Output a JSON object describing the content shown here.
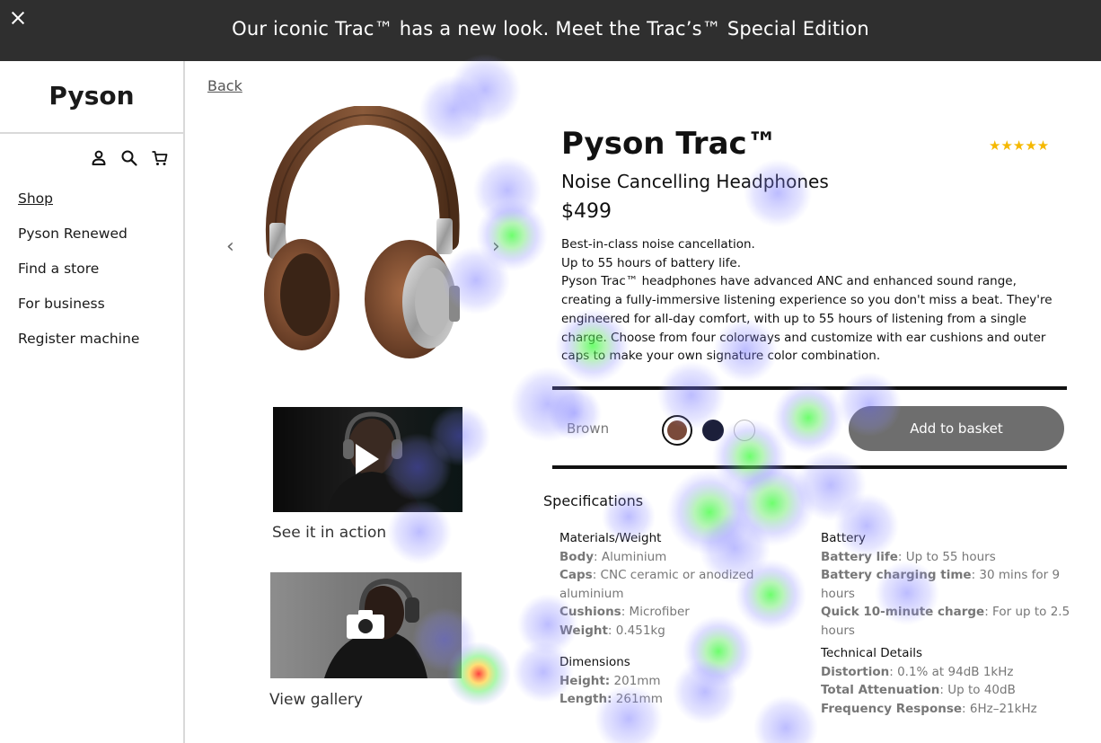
{
  "banner": {
    "text": "Our iconic Trac™ has a new look. Meet the Trac’s™ Special Edition",
    "close_icon": "close-icon"
  },
  "sidebar": {
    "logo": "Pyson",
    "icons": [
      "user-icon",
      "search-icon",
      "cart-icon"
    ],
    "nav": [
      {
        "label": "Shop"
      },
      {
        "label": "Pyson Renewed"
      },
      {
        "label": "Find a store"
      },
      {
        "label": "For business"
      },
      {
        "label": "Register machine"
      }
    ]
  },
  "main": {
    "back_label": "Back",
    "carousel": {
      "prev": "‹",
      "next": "›"
    },
    "media": {
      "video_caption": "See it in action",
      "gallery_caption": "View gallery"
    },
    "product": {
      "title": "Pyson Trac™",
      "subtitle": "Noise Cancelling Headphones",
      "price": "$499",
      "rating_stars": "★★★★★",
      "rating_value": 5,
      "description": [
        "Best-in-class noise cancellation.",
        "Up to 55 hours of battery life.",
        "Pyson Trac™ headphones have advanced ANC and enhanced sound range, creating a fully-immersive listening experience so you don't miss a beat. They're engineered for all-day comfort, with up to 55 hours of listening from a single charge. Choose from four colorways and customize with ear cushions and outer caps to make your own signature color combination."
      ],
      "selected_color": "Brown",
      "colors": [
        "#7a4a3a",
        "#1c1f3a",
        "#ffffff"
      ],
      "add_to_basket": "Add to basket"
    },
    "specs": {
      "heading": "Specifications",
      "materials": {
        "title": "Materials/Weight",
        "rows": [
          {
            "k": "Body",
            "v": ": Aluminium"
          },
          {
            "k": "Caps",
            "v": ": CNC ceramic or anodized aluminium"
          },
          {
            "k": "Cushions",
            "v": ": Microfiber"
          },
          {
            "k": "Weight",
            "v": ": 0.451kg"
          }
        ]
      },
      "dimensions": {
        "title": "Dimensions",
        "rows": [
          {
            "k": "Height:",
            "v": " 201mm"
          },
          {
            "k": "Length:",
            "v": " 261mm"
          }
        ]
      },
      "battery": {
        "title": "Battery",
        "rows": [
          {
            "k": "Battery life",
            "v": ": Up to 55 hours"
          },
          {
            "k": "Battery charging time",
            "v": ": 30 mins for 9 hours"
          },
          {
            "k": "Quick 10-minute charge",
            "v": ": For up to 2.5 hours"
          }
        ]
      },
      "technical": {
        "title": "Technical Details",
        "rows": [
          {
            "k": "Distortion",
            "v": ": 0.1% at 94dB 1kHz"
          },
          {
            "k": "Total Attenuation",
            "v": ": Up to 40dB"
          },
          {
            "k": "Frequency Response",
            "v": ": 6Hz–21kHz"
          }
        ]
      }
    }
  },
  "colors": {
    "banner_bg": "#2f2f2f",
    "button_bg": "#6e6e6e",
    "star": "#f5b800"
  }
}
